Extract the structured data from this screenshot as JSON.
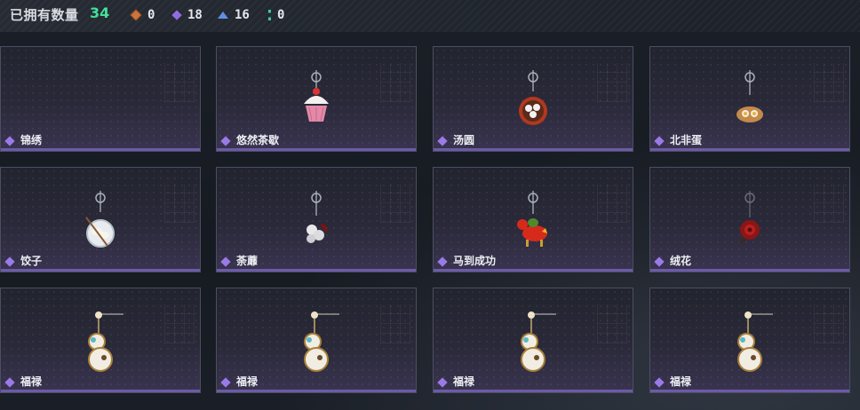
{
  "header": {
    "owned_label": "已拥有数量",
    "owned_count": "34",
    "stats": [
      {
        "icon": "orange-diamond-icon",
        "value": "0"
      },
      {
        "icon": "purple-diamond-icon",
        "value": "18"
      },
      {
        "icon": "blue-chevron-icon",
        "value": "16"
      },
      {
        "icon": "teal-bar-icon",
        "value": "0"
      }
    ]
  },
  "items": [
    {
      "name": "锦绣",
      "icon": "empty"
    },
    {
      "name": "悠然茶歇",
      "icon": "cupcake-icon"
    },
    {
      "name": "汤圆",
      "icon": "tangyuan-bowl-icon"
    },
    {
      "name": "北非蛋",
      "icon": "shakshuka-icon"
    },
    {
      "name": "饺子",
      "icon": "dumpling-plate-icon"
    },
    {
      "name": "荼蘼",
      "icon": "white-flower-icon"
    },
    {
      "name": "马到成功",
      "icon": "red-horse-icon"
    },
    {
      "name": "绒花",
      "icon": "red-flower-icon"
    },
    {
      "name": "福禄",
      "icon": "gourd-charm-icon"
    },
    {
      "name": "福禄",
      "icon": "gourd-charm-icon"
    },
    {
      "name": "福禄",
      "icon": "gourd-charm-icon"
    },
    {
      "name": "福禄",
      "icon": "gourd-charm-icon"
    }
  ],
  "colors": {
    "accent_green": "#3fe09a",
    "rarity_purple": "#9a7ae8"
  }
}
